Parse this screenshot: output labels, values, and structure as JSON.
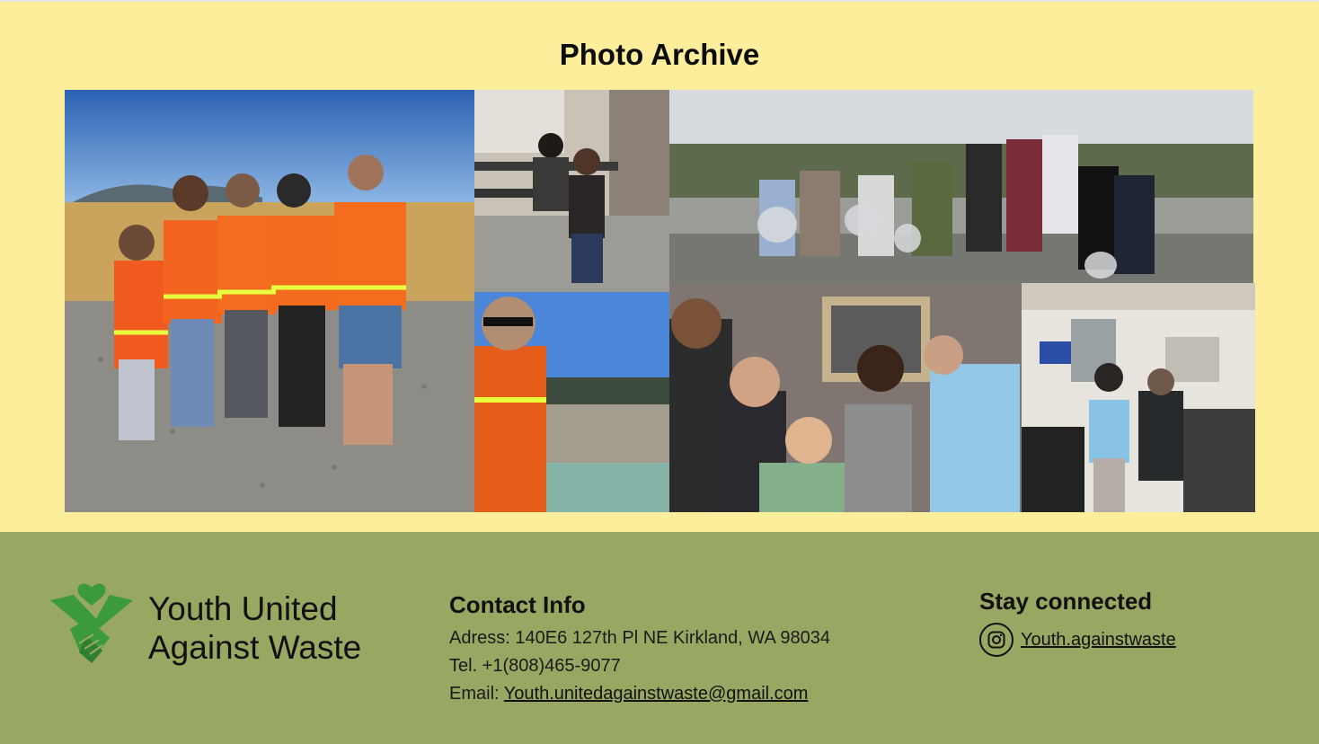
{
  "archive": {
    "title": "Photo Archive",
    "photos": [
      {
        "id": "photo-field-group",
        "desc": "field group in safety vests"
      },
      {
        "id": "photo-classroom-pair"
      },
      {
        "id": "photo-cleanup-group"
      },
      {
        "id": "photo-quarry-view"
      },
      {
        "id": "photo-office-group"
      },
      {
        "id": "photo-classroom-group"
      }
    ]
  },
  "footer": {
    "brand_line1": "Youth United",
    "brand_line2": "Against Waste",
    "contact": {
      "heading": "Contact Info",
      "address": "Adress: 140E6 127th Pl NE Kirkland, WA 98034",
      "phone": "Tel. +1(808)465-9077",
      "email_label": "Email: ",
      "email": "Youth.unitedagainstwaste@gmail.com"
    },
    "social": {
      "heading": "Stay connected",
      "instagram_handle": "Youth.againstwaste",
      "icon": "instagram-icon"
    }
  },
  "colors": {
    "background_top": "#fdee9b",
    "background_footer": "#98a862",
    "logo_green": "#3b9a3c"
  }
}
